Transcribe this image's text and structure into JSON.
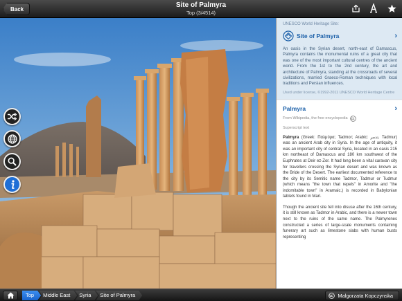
{
  "topbar": {
    "back_label": "Back",
    "title": "Site of Palmyra",
    "subtitle": "Top (3/4514)",
    "icons": [
      "share-icon",
      "text-size-icon",
      "star-icon"
    ]
  },
  "photo": {
    "buttons": [
      "shuffle-icon",
      "globe-icon",
      "search-icon",
      "info-icon"
    ]
  },
  "panel": {
    "unesco": {
      "label": "UNESCO World Heritage Site:",
      "title": "Site of Palmyra",
      "text": "An oasis in the Syrian desert, north-east of Damascus, Palmyra contains the monumental ruins of a great city that was one of the most important cultural centres of the ancient world. From the 1st to the 2nd century, the art and architecture of Palmyra, standing at the crossroads of several civilizations, married Graeco-Roman techniques with local traditions and Persian influences.",
      "credit": "Used under license, ©1992-2011 UNESCO World Heritage Centre"
    },
    "wiki": {
      "title": "Palmyra",
      "source": "From Wikipedia, the free encyclopedia",
      "sup": "Superscript text",
      "p1_name": "Palmyra",
      "p1": " (Greek: Παλμύρα; Tadmor; Arabic: تدمر, Tadmur) was an ancient Arab city in Syria. In the age of antiquity, it was an important city of central Syria, located in an oasis 215 km northeast of Damascus and 180 km southwest of the Euphrates at Deir ez-Zor. It had long been a vital caravan city for travellers crossing the Syrian desert and was known as the Bride of the Desert. The earliest documented reference to the city by its Semitic name Tadmor, Tadmur or Tudmur (which means \"the town that repels\" in Amorite and \"the indomitable town\" in Aramaic.) is recorded in Babylonian tablets found in Mari.",
      "p2": "Though the ancient site fell into disuse after the 16th century, it is still known as Tadmor in Arabic, and there is a newer town next to the ruins of the same name. The Palmyrenes constructed a series of large-scale monuments containing funerary art such as limestone slabs with human busts representing"
    }
  },
  "bottombar": {
    "crumbs": [
      "Top",
      "Middle East",
      "Syria",
      "Site of Palmyra"
    ],
    "credit": "Malgorzata Kopczynska"
  },
  "colors": {
    "accent": "#1a5fa8",
    "active_crumb": "#2a7be8",
    "unesco_bg": "#dde9f3"
  }
}
